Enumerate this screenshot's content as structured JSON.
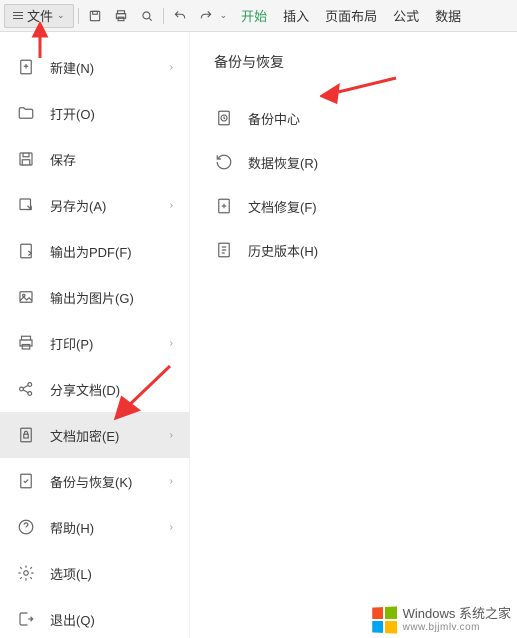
{
  "toolbar": {
    "file_label": "文件",
    "tabs": [
      "开始",
      "插入",
      "页面布局",
      "公式",
      "数据"
    ]
  },
  "sidebar": {
    "items": [
      {
        "label": "新建(N)",
        "arrow": true
      },
      {
        "label": "打开(O)"
      },
      {
        "label": "保存"
      },
      {
        "label": "另存为(A)",
        "arrow": true
      },
      {
        "label": "输出为PDF(F)"
      },
      {
        "label": "输出为图片(G)"
      },
      {
        "label": "打印(P)",
        "arrow": true
      },
      {
        "label": "分享文档(D)"
      },
      {
        "label": "文档加密(E)",
        "arrow": true,
        "selected": true
      },
      {
        "label": "备份与恢复(K)",
        "arrow": true
      },
      {
        "label": "帮助(H)",
        "arrow": true
      },
      {
        "label": "选项(L)"
      },
      {
        "label": "退出(Q)"
      }
    ]
  },
  "content": {
    "title": "备份与恢复",
    "items": [
      {
        "label": "备份中心"
      },
      {
        "label": "数据恢复(R)"
      },
      {
        "label": "文档修复(F)"
      },
      {
        "label": "历史版本(H)"
      }
    ]
  },
  "watermark": {
    "brand": "Windows",
    "suffix": "系统之家",
    "url": "www.bjjmlv.com"
  }
}
